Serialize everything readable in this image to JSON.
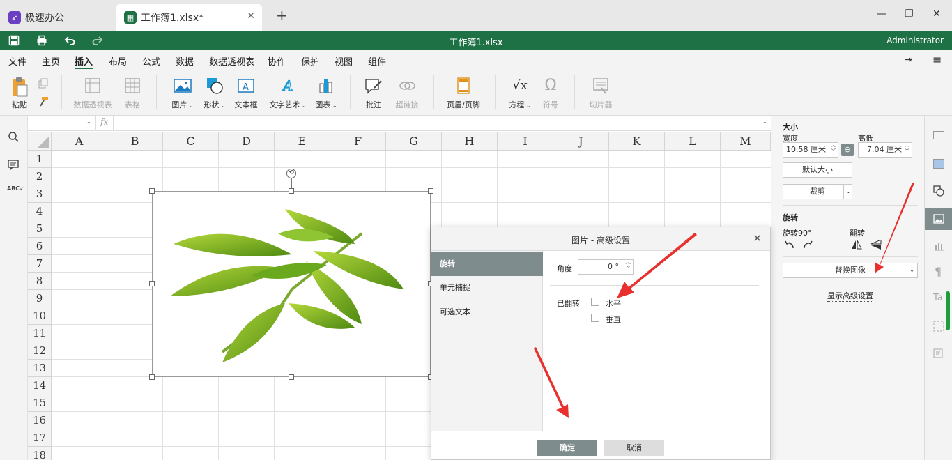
{
  "tabs": [
    {
      "label": "极速办公",
      "icon": "rocket-icon"
    },
    {
      "label": "工作簿1.xlsx*",
      "icon": "spreadsheet-icon"
    }
  ],
  "title": "工作簿1.xlsx",
  "user": "Administrator",
  "menus": [
    "文件",
    "主页",
    "插入",
    "布局",
    "公式",
    "数据",
    "数据透视表",
    "协作",
    "保护",
    "视图",
    "组件"
  ],
  "active_menu": "插入",
  "ribbon": {
    "paste": "粘贴",
    "pivot": "数据透视表",
    "table": "表格",
    "picture": "图片",
    "shape": "形状",
    "textbox": "文本框",
    "wordart": "文字艺术",
    "chart": "图表",
    "comment": "批注",
    "hyperlink": "超链接",
    "header_footer": "页眉/页脚",
    "equation": "方程",
    "symbol": "符号",
    "slicer": "切片器"
  },
  "formula": {
    "fx": "fx"
  },
  "columns": [
    "A",
    "B",
    "C",
    "D",
    "E",
    "F",
    "G",
    "H",
    "I",
    "J",
    "K",
    "L",
    "M"
  ],
  "rows": [
    "1",
    "2",
    "3",
    "4",
    "5",
    "6",
    "7",
    "8",
    "9",
    "10",
    "11",
    "12",
    "13",
    "14",
    "15",
    "16",
    "17",
    "18"
  ],
  "panel": {
    "size_title": "大小",
    "width_label": "宽度",
    "height_label": "高低",
    "width_value": "10.58 厘米",
    "height_value": "7.04 厘米",
    "default_size": "默认大小",
    "crop": "裁剪",
    "rotate_title": "旋转",
    "rotate90": "旋转90°",
    "flip": "翻转",
    "replace_image": "替换图像",
    "advanced": "显示高级设置"
  },
  "dialog": {
    "title": "图片 - 高级设置",
    "nav": [
      "旋转",
      "单元捕捉",
      "可选文本"
    ],
    "angle_label": "角度",
    "angle_value": "0 °",
    "flipped_label": "已翻转",
    "horizontal": "水平",
    "vertical": "垂直",
    "ok": "确定",
    "cancel": "取消"
  },
  "colors": {
    "brand": "#1e7145",
    "accent_arrow": "#e8312e"
  }
}
